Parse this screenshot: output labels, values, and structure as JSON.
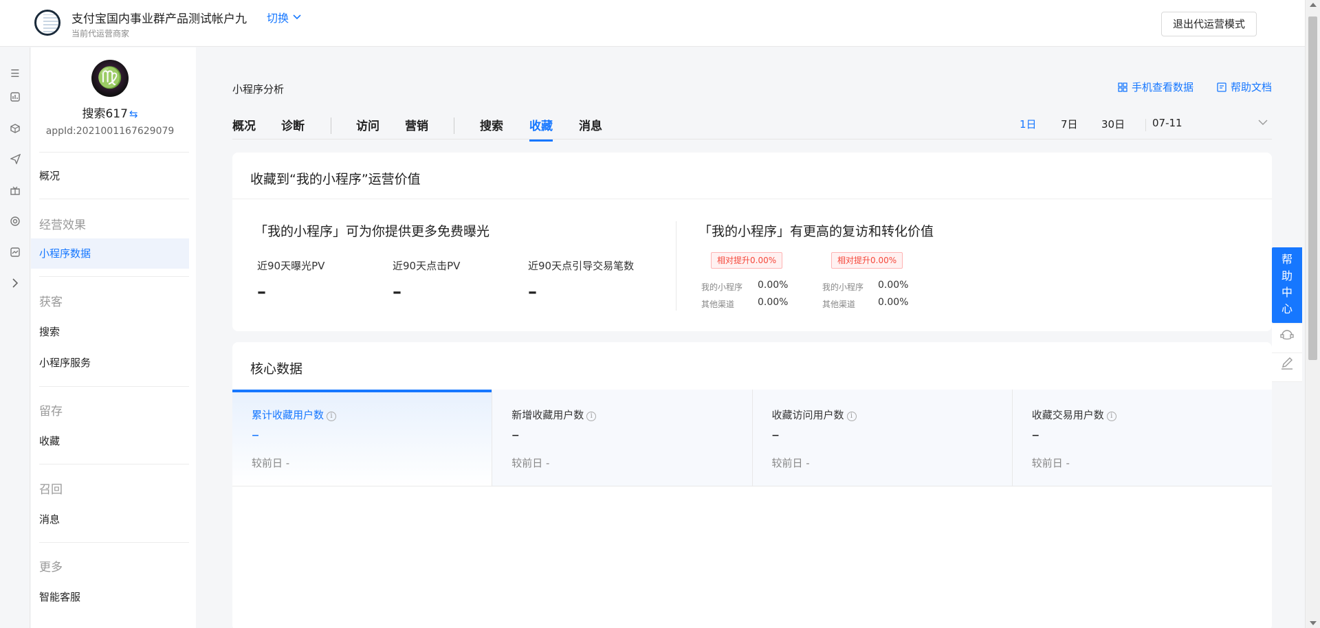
{
  "header": {
    "account_title": "支付宝国内事业群产品测试帐户九",
    "switch_label": "切换",
    "account_subtitle": "当前代运营商家",
    "exit_button": "退出代运营模式"
  },
  "rail_icons": [
    "menu-icon",
    "chart-icon",
    "cube-icon",
    "send-icon",
    "gift-icon",
    "target-icon",
    "monitor-icon",
    "chevron-right-icon"
  ],
  "sidebar": {
    "mini_program_name": "搜索617",
    "swap_glyph": "⇆",
    "avatar_glyph": "♍",
    "appid": "appId:2021001167629079",
    "items": [
      {
        "label": "概况"
      },
      {
        "section": "经营效果"
      },
      {
        "label": "小程序数据",
        "active": true
      },
      {
        "section": "获客"
      },
      {
        "label": "搜索"
      },
      {
        "label": "小程序服务"
      },
      {
        "section": "留存"
      },
      {
        "label": "收藏"
      },
      {
        "section": "召回"
      },
      {
        "label": "消息"
      },
      {
        "section": "更多"
      },
      {
        "label": "智能客服"
      }
    ]
  },
  "main": {
    "page_title": "小程序分析",
    "links": {
      "mobile": "手机查看数据",
      "help_doc": "帮助文档"
    },
    "tabs": [
      "概况",
      "诊断",
      "访问",
      "营销",
      "搜索",
      "收藏",
      "消息"
    ],
    "active_tab": "收藏",
    "ranges": [
      "1日",
      "7日",
      "30日"
    ],
    "active_range": "1日",
    "date": "07-11",
    "value_card": {
      "title": "收藏到“我的小程序”运营价值",
      "left_heading": "「我的小程序」可为你提供更多免费曝光",
      "metrics": [
        {
          "label": "近90天曝光PV",
          "value": "–"
        },
        {
          "label": "近90天点击PV",
          "value": "–"
        },
        {
          "label": "近90天点引导交易笔数",
          "value": "–"
        }
      ],
      "right_heading": "「我的小程序」有更高的复访和转化价值",
      "compares": [
        {
          "tag": "相对提升0.00%",
          "rows": [
            {
              "label": "我的小程序",
              "value": "0.00%"
            },
            {
              "label": "其他渠道",
              "value": "0.00%"
            }
          ]
        },
        {
          "tag": "相对提升0.00%",
          "rows": [
            {
              "label": "我的小程序",
              "value": "0.00%"
            },
            {
              "label": "其他渠道",
              "value": "0.00%"
            }
          ]
        }
      ]
    },
    "core": {
      "title": "核心数据",
      "tiles": [
        {
          "label": "累计收藏用户数",
          "value": "–",
          "compare": "较前日 -"
        },
        {
          "label": "新增收藏用户数",
          "value": "–",
          "compare": "较前日 -"
        },
        {
          "label": "收藏访问用户数",
          "value": "–",
          "compare": "较前日 -"
        },
        {
          "label": "收藏交易用户数",
          "value": "–",
          "compare": "较前日 -"
        }
      ]
    }
  },
  "float": {
    "help_chars": [
      "帮",
      "助",
      "中",
      "心"
    ]
  },
  "colors": {
    "accent": "#1677ff",
    "tag_red": "#f5483b"
  }
}
